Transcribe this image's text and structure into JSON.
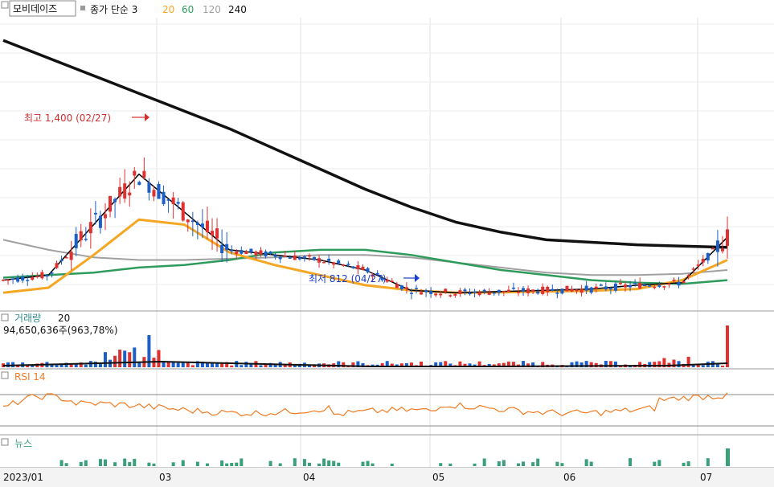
{
  "header": {
    "stock_name": "모비데이즈",
    "ma_label": "종가 단순 3",
    "ma_periods": [
      {
        "label": "20",
        "color": "#f5a623"
      },
      {
        "label": "60",
        "color": "#2e9b5c"
      },
      {
        "label": "120",
        "color": "#a0a0a0"
      },
      {
        "label": "240",
        "color": "#111111"
      }
    ]
  },
  "annotations": {
    "high": "최고 1,400 (02/27)",
    "low": "최저 812 (04/27)"
  },
  "volume_panel": {
    "title": "거래량",
    "period": "20",
    "info": "94,650,636주(963,78%)"
  },
  "rsi_panel": {
    "title": "RSI 14"
  },
  "news_panel": {
    "title": "뉴스"
  },
  "x_axis_labels": [
    "2023/01",
    "03",
    "04",
    "05",
    "06",
    "07"
  ],
  "colors": {
    "up": "#e03131",
    "down": "#1c5fc9",
    "ma3": "#000000",
    "ma20": "#f5a623",
    "ma60": "#2e9b5c",
    "ma120": "#a0a0a0",
    "ma240": "#111111",
    "rsi": "#f07b22",
    "news": "#3aa07a",
    "panel_title": "#2f8f8f"
  },
  "chart_data": {
    "type": "candlestick",
    "high": {
      "value": 1400,
      "date": "02/27"
    },
    "low": {
      "value": 812,
      "date": "04/27"
    },
    "last_volume": 94650636,
    "last_volume_ratio_pct": 963.78,
    "rsi_period": 14,
    "series": [
      {
        "name": "3",
        "values": [
          880,
          900,
          1100,
          1300,
          1150,
          1000,
          980,
          960,
          920,
          840,
          830,
          835,
          840,
          845,
          860,
          870,
          1050
        ]
      },
      {
        "name": "20",
        "values": [
          830,
          850,
          980,
          1120,
          1100,
          990,
          940,
          900,
          860,
          840,
          830,
          832,
          835,
          838,
          845,
          880,
          960
        ]
      },
      {
        "name": "60",
        "values": [
          890,
          900,
          910,
          930,
          940,
          960,
          990,
          1000,
          1000,
          980,
          950,
          920,
          900,
          880,
          870,
          865,
          880
        ]
      },
      {
        "name": "120",
        "values": [
          1040,
          1000,
          970,
          960,
          960,
          965,
          970,
          980,
          980,
          970,
          950,
          930,
          910,
          900,
          900,
          905,
          920
        ]
      },
      {
        "name": "240",
        "values": [
          1830,
          1760,
          1690,
          1620,
          1550,
          1480,
          1400,
          1320,
          1240,
          1170,
          1110,
          1070,
          1040,
          1030,
          1020,
          1015,
          1010
        ]
      }
    ]
  }
}
